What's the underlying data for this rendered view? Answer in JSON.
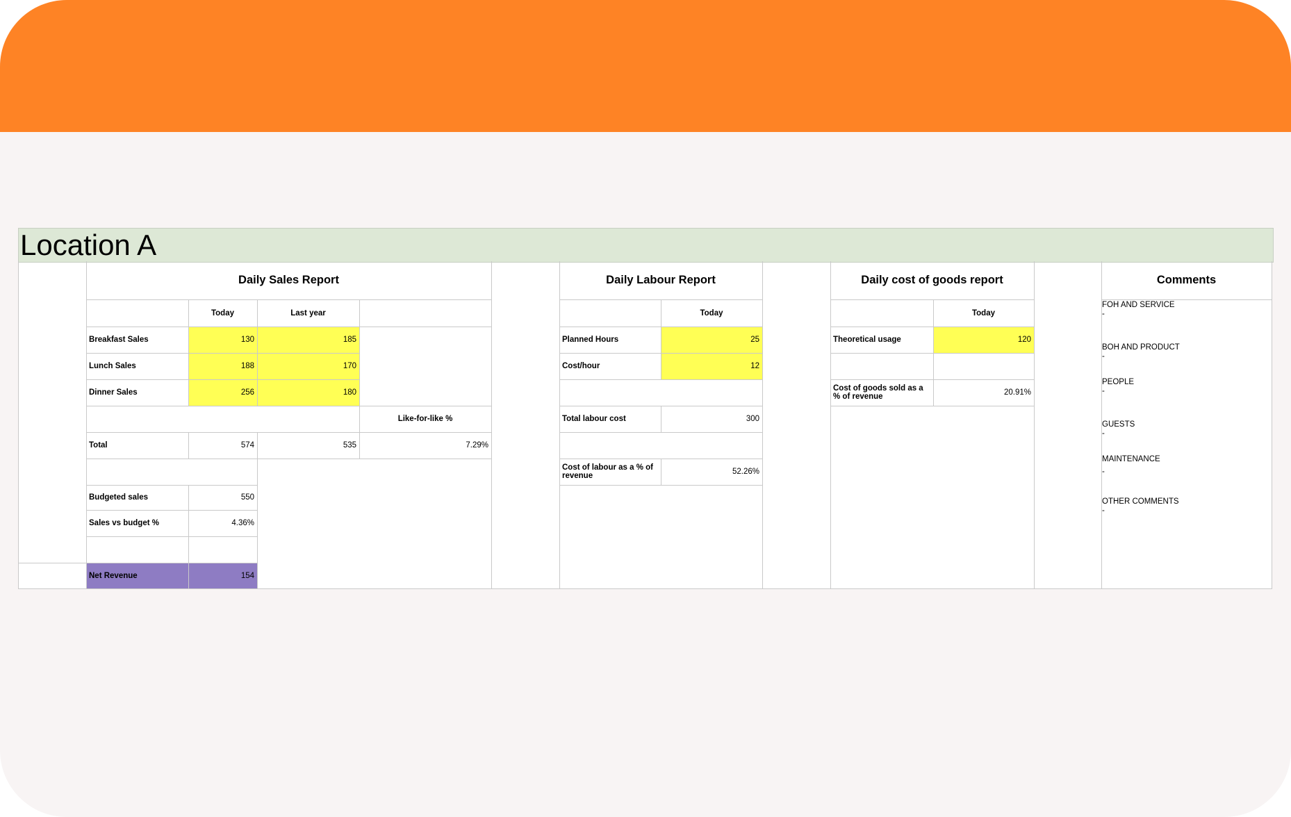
{
  "sheet": {
    "title": "Location A"
  },
  "sales": {
    "title": "Daily Sales Report",
    "col_today": "Today",
    "col_last_year": "Last year",
    "breakfast": {
      "label": "Breakfast Sales",
      "today": "130",
      "last_year": "185"
    },
    "lunch": {
      "label": "Lunch Sales",
      "today": "188",
      "last_year": "170"
    },
    "dinner": {
      "label": "Dinner Sales",
      "today": "256",
      "last_year": "180"
    },
    "lfl_label": "Like-for-like %",
    "total": {
      "label": "Total",
      "today": "574",
      "last_year": "535",
      "lfl": "7.29%"
    },
    "budgeted": {
      "label": "Budgeted sales",
      "value": "550"
    },
    "vs_budget": {
      "label": "Sales vs budget %",
      "value": "4.36%"
    },
    "net_revenue": {
      "label": "Net Revenue",
      "value": "154"
    }
  },
  "labour": {
    "title": "Daily Labour Report",
    "col_today": "Today",
    "planned_hours": {
      "label": "Planned Hours",
      "value": "25"
    },
    "cost_hour": {
      "label": "Cost/hour",
      "value": "12"
    },
    "total_cost": {
      "label": "Total labour cost",
      "value": "300"
    },
    "pct_revenue": {
      "label": "Cost of labour as a % of revenue",
      "value": "52.26%"
    }
  },
  "cogs": {
    "title": "Daily cost of goods report",
    "col_today": "Today",
    "theoretical": {
      "label": "Theoretical usage",
      "value": "120"
    },
    "pct_revenue": {
      "label": "Cost of goods sold as a % of revenue",
      "value": "20.91%"
    }
  },
  "comments": {
    "title": "Comments",
    "items": [
      {
        "label": "FOH AND SERVICE",
        "value": "-"
      },
      {
        "label": "BOH AND PRODUCT",
        "value": "-"
      },
      {
        "label": "PEOPLE",
        "value": "-"
      },
      {
        "label": "GUESTS",
        "value": "-"
      },
      {
        "label": "MAINTENANCE",
        "value": "-"
      },
      {
        "label": "OTHER COMMENTS",
        "value": "-"
      }
    ]
  },
  "colors": {
    "banner": "#fe8325",
    "title_band": "#dde8d6",
    "input_highlight": "#ffff55",
    "net_revenue_highlight": "#8e7cc3"
  }
}
